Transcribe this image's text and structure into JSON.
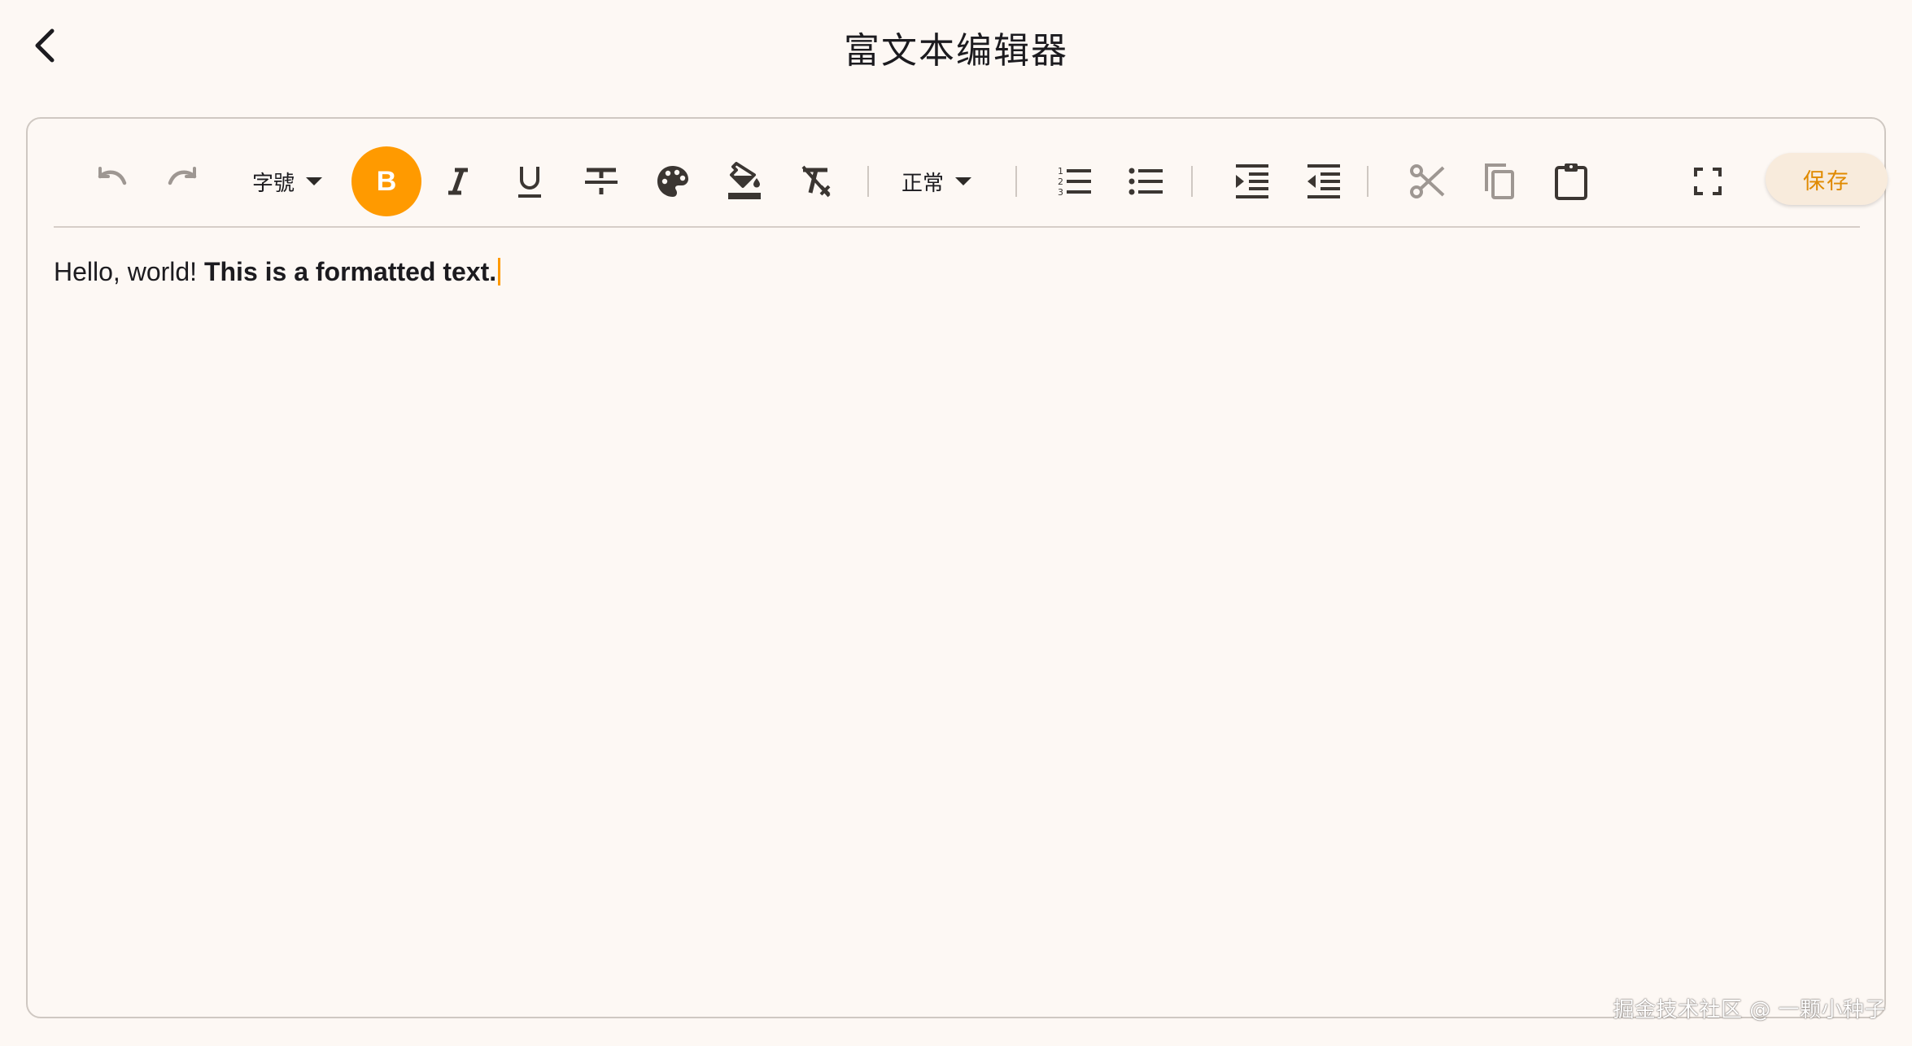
{
  "app_bar": {
    "title": "富文本编辑器",
    "back_icon": "chevron-left-icon"
  },
  "toolbar": {
    "undo_icon": "undo-icon",
    "redo_icon": "redo-icon",
    "font_size_label": "字號",
    "bold_letter": "B",
    "bold_active": true,
    "italic_icon": "italic-icon",
    "underline_icon": "underline-icon",
    "strikethrough_icon": "strikethrough-icon",
    "text_color_icon": "palette-icon",
    "background_color_icon": "fill-bucket-icon",
    "clear_format_icon": "clear-format-icon",
    "heading_label": "正常",
    "ordered_list_icon": "ordered-list-icon",
    "unordered_list_icon": "unordered-list-icon",
    "indent_icon": "indent-increase-icon",
    "outdent_icon": "indent-decrease-icon",
    "cut_icon": "scissors-icon",
    "copy_icon": "copy-icon",
    "paste_icon": "clipboard-icon",
    "fullscreen_icon": "fullscreen-icon",
    "save_label": "保存"
  },
  "editor": {
    "plain_text": "Hello, world! ",
    "bold_text": "This is a formatted text."
  },
  "watermark": "掘金技术社区 @ 一颗小种子",
  "colors": {
    "accent": "#ff9a00",
    "background": "#fdf8f4",
    "icon_dark": "#3b3632",
    "icon_disabled": "#9e9792"
  }
}
